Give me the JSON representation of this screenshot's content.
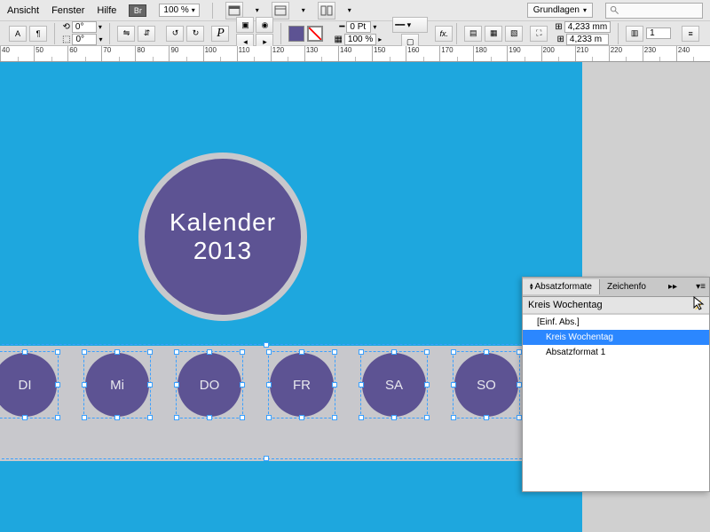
{
  "menubar": {
    "view": "Ansicht",
    "window": "Fenster",
    "help": "Hilfe",
    "bridge": "Br",
    "zoom": "100 %",
    "workspace": "Grundlagen"
  },
  "control": {
    "angle0": "0°",
    "angle1": "0°",
    "strokePt": "0 Pt",
    "percent100": "100 %",
    "w": "4,233 mm",
    "h": "4,233 m",
    "cols": "1"
  },
  "ruler": [
    "40",
    "50",
    "60",
    "70",
    "80",
    "90",
    "100",
    "110",
    "120",
    "130",
    "140",
    "150",
    "160",
    "170",
    "180",
    "190",
    "200",
    "210",
    "220",
    "230",
    "240"
  ],
  "calendar": {
    "title1": "Kalender",
    "title2": "2013",
    "days": [
      "DI",
      "Mi",
      "DO",
      "FR",
      "SA",
      "SO"
    ]
  },
  "panel": {
    "tab1": "Absatzformate",
    "tab2": "Zeichenfo",
    "current": "Kreis Wochentag",
    "styles": [
      "[Einf. Abs.]",
      "Kreis Wochentag",
      "Absatzformat 1"
    ]
  }
}
